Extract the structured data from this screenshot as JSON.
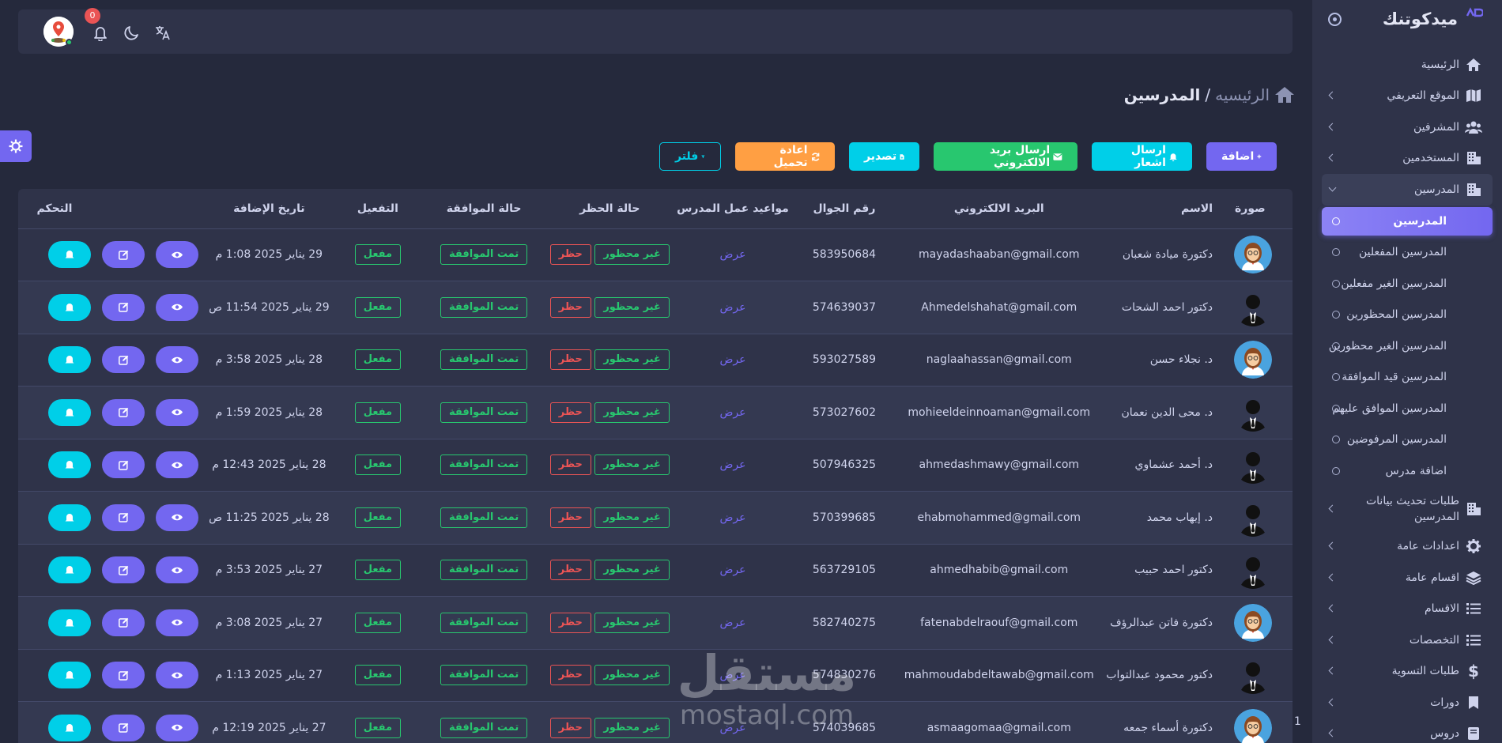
{
  "brand": {
    "name": "ميدكوتنك"
  },
  "navbar": {
    "notification_count": "0"
  },
  "breadcrumb": {
    "root": "الرئيسيه",
    "separator": "/",
    "current": "المدرسين"
  },
  "sidebar": {
    "items": [
      {
        "label": "الرئيسية",
        "icon": "home-icon"
      },
      {
        "label": "الموقع التعريفي",
        "icon": "map-icon"
      },
      {
        "label": "المشرفين",
        "icon": "users-icon"
      },
      {
        "label": "المستخدمين",
        "icon": "building-icon"
      },
      {
        "label": "المدرسين",
        "icon": "building-icon"
      }
    ],
    "teachers_sub": [
      {
        "label": "المدرسين"
      },
      {
        "label": "المدرسين المفعلين"
      },
      {
        "label": "المدرسين الغير مفعلين"
      },
      {
        "label": "المدرسين المحظورين"
      },
      {
        "label": "المدرسين الغير محظورين"
      },
      {
        "label": "المدرسين قيد الموافقة"
      },
      {
        "label": "المدرسين الموافق عليهم"
      },
      {
        "label": "المدرسين المرفوضين"
      },
      {
        "label": "اضافة مدرس"
      }
    ],
    "rest": [
      {
        "label": "طلبات تحديث بيانات المدرسين",
        "icon": "building-icon"
      },
      {
        "label": "اعدادات عامة",
        "icon": "gear-icon"
      },
      {
        "label": "اقسام عامة",
        "icon": "layers-icon"
      },
      {
        "label": "الاقسام",
        "icon": "list-icon"
      },
      {
        "label": "التخصصات",
        "icon": "list-icon"
      },
      {
        "label": "طلبات التسوية",
        "icon": "dollar-icon"
      },
      {
        "label": "دورات",
        "icon": "bookmark-icon"
      },
      {
        "label": "دروس",
        "icon": "book-icon"
      }
    ]
  },
  "actions": {
    "add": "اضافة",
    "notify": "ارسال اشعار",
    "email": "ارسال بريد الالكتروني",
    "export": "تصدير",
    "reload": "اعادة تحميل",
    "filter": "فلتر"
  },
  "table": {
    "headers": {
      "photo": "صورة",
      "name": "الاسم",
      "email": "البريد الالكتروني",
      "phone": "رقم الجوال",
      "schedule": "مواعيد عمل المدرس",
      "ban": "حالة الحظر",
      "approval": "حالة الموافقة",
      "activation": "التفعيل",
      "date": "تاريخ الإضافة",
      "control": "التحكم"
    },
    "rows": [
      {
        "avatar": "female",
        "name": "دكتورة ميادة شعبان",
        "email": "mayadashaaban@gmail.com",
        "phone": "583950684",
        "schedule": "عرض",
        "not_banned": "غير محظور",
        "ban": "حظر",
        "approval": "تمت الموافقة",
        "activation": "مفعل",
        "date": "29 يناير 2025 1:08 م"
      },
      {
        "avatar": "male",
        "name": "دكتور احمد الشحات",
        "email": "Ahmedelshahat@gmail.com",
        "phone": "574639037",
        "schedule": "عرض",
        "not_banned": "غير محظور",
        "ban": "حظر",
        "approval": "تمت الموافقة",
        "activation": "مفعل",
        "date": "29 يناير 2025 11:54 ص"
      },
      {
        "avatar": "female",
        "name": "د. نجلاء حسن",
        "email": "naglaahassan@gmail.com",
        "phone": "593027589",
        "schedule": "عرض",
        "not_banned": "غير محظور",
        "ban": "حظر",
        "approval": "تمت الموافقة",
        "activation": "مفعل",
        "date": "28 يناير 2025 3:58 م"
      },
      {
        "avatar": "male",
        "name": "د. محى الدين نعمان",
        "email": "mohieeldeinnoaman@gmail.com",
        "phone": "573027602",
        "schedule": "عرض",
        "not_banned": "غير محظور",
        "ban": "حظر",
        "approval": "تمت الموافقة",
        "activation": "مفعل",
        "date": "28 يناير 2025 1:59 م"
      },
      {
        "avatar": "male",
        "name": "د. أحمد عشماوي",
        "email": "ahmedashmawy@gmail.com",
        "phone": "507946325",
        "schedule": "عرض",
        "not_banned": "غير محظور",
        "ban": "حظر",
        "approval": "تمت الموافقة",
        "activation": "مفعل",
        "date": "28 يناير 2025 12:43 م"
      },
      {
        "avatar": "male",
        "name": "د. إيهاب محمد",
        "email": "ehabmohammed@gmail.com",
        "phone": "570399685",
        "schedule": "عرض",
        "not_banned": "غير محظور",
        "ban": "حظر",
        "approval": "تمت الموافقة",
        "activation": "مفعل",
        "date": "28 يناير 2025 11:25 ص"
      },
      {
        "avatar": "male",
        "name": "دكتور احمد حبيب",
        "email": "ahmedhabib@gmail.com",
        "phone": "563729105",
        "schedule": "عرض",
        "not_banned": "غير محظور",
        "ban": "حظر",
        "approval": "تمت الموافقة",
        "activation": "مفعل",
        "date": "27 يناير 2025 3:53 م"
      },
      {
        "avatar": "female",
        "name": "دكتورة فاتن عبدالرؤف",
        "email": "fatenabdelraouf@gmail.com",
        "phone": "582740275",
        "schedule": "عرض",
        "not_banned": "غير محظور",
        "ban": "حظر",
        "approval": "تمت الموافقة",
        "activation": "مفعل",
        "date": "27 يناير 2025 3:08 م"
      },
      {
        "avatar": "male",
        "name": "دكتور محمود عبدالتواب",
        "email": "mahmoudabdeltawab@gmail.com",
        "phone": "574830276",
        "schedule": "عرض",
        "not_banned": "غير محظور",
        "ban": "حظر",
        "approval": "تمت الموافقة",
        "activation": "مفعل",
        "date": "27 يناير 2025 1:13 م"
      },
      {
        "avatar": "female",
        "name": "دكتورة أسماء جمعه",
        "email": "asmaagomaa@gmail.com",
        "phone": "574039685",
        "schedule": "عرض",
        "not_banned": "غير محظور",
        "ban": "حظر",
        "approval": "تمت الموافقة",
        "activation": "مفعل",
        "date": "27 يناير 2025 12:19 م"
      }
    ]
  },
  "pagination": {
    "page_fragment": "1"
  },
  "watermark": {
    "arabic": "مستقل",
    "latin": "mostaql.com"
  },
  "colors": {
    "primary": "#7367f0",
    "info": "#00cfe8",
    "success": "#28c76f",
    "warning": "#ff9f43",
    "danger": "#ea5455",
    "bg": "#25293c",
    "card": "#2f3349"
  }
}
